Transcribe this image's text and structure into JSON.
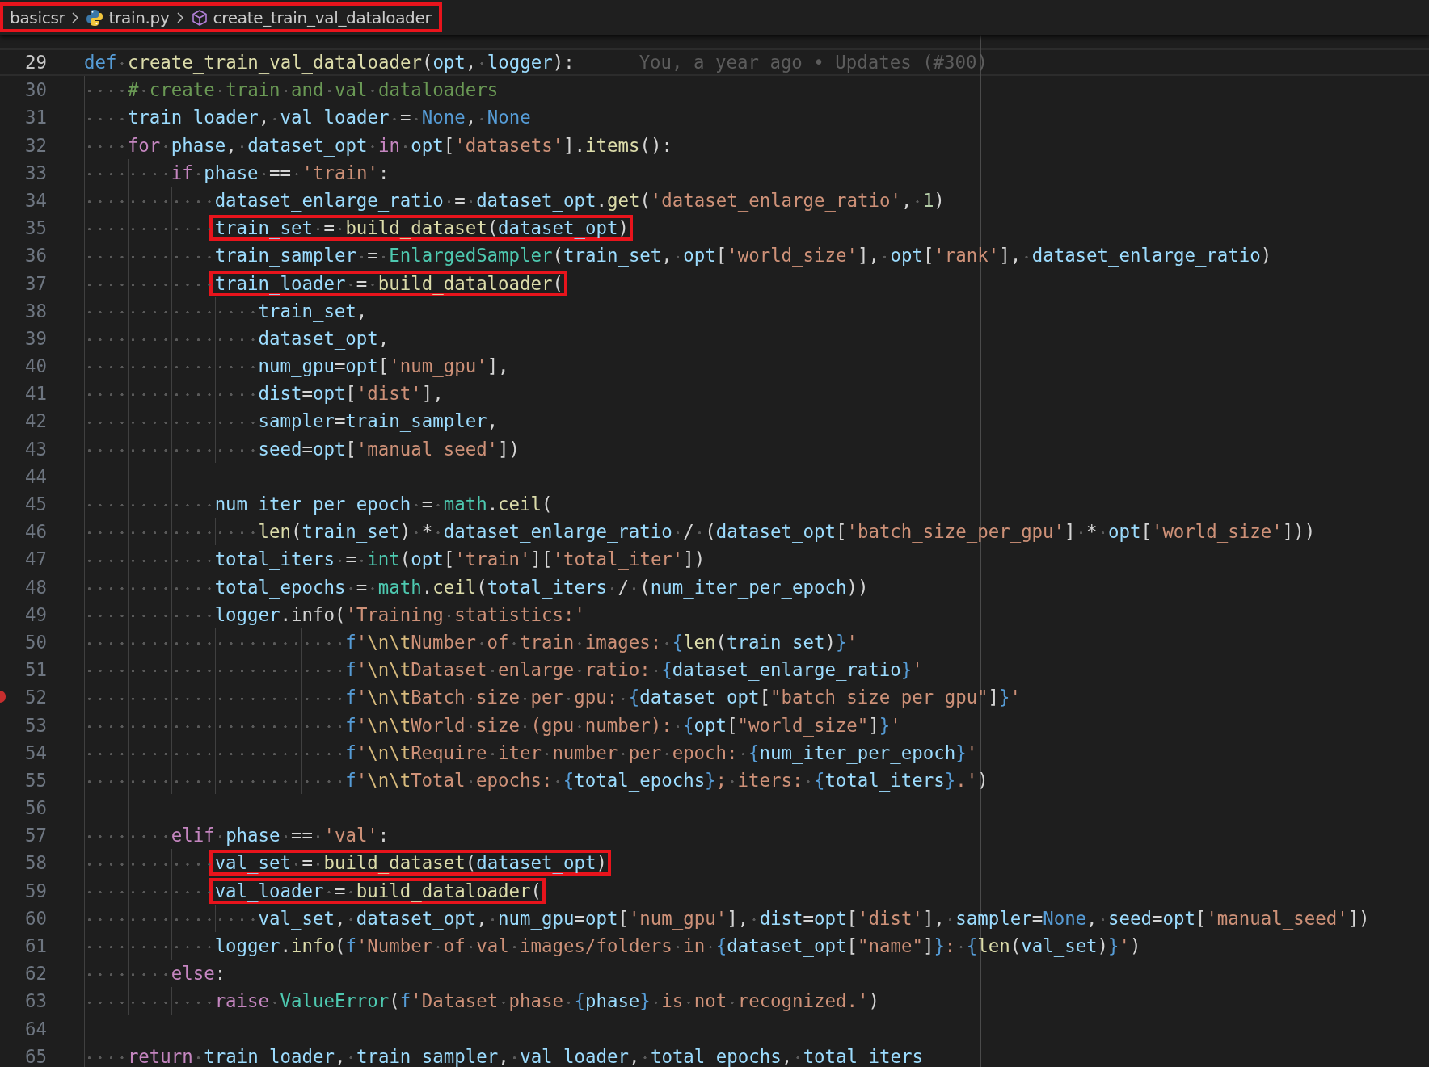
{
  "breadcrumb": {
    "boxed": true,
    "items": [
      {
        "label": "basicsr",
        "kind": "folder"
      },
      {
        "label": "train.py",
        "kind": "file"
      },
      {
        "label": "create_train_val_dataloader",
        "kind": "symbol"
      }
    ]
  },
  "lines": [
    {
      "number": "29",
      "current": true,
      "blame": "You, a year ago • Updates (#300)",
      "tokens": [
        {
          "kind": "keyword",
          "text": "def "
        },
        {
          "kind": "function",
          "text": "create_train_val_dataloader"
        },
        {
          "kind": "punct",
          "text": "("
        },
        {
          "kind": "variable",
          "text": "opt"
        },
        {
          "kind": "punct",
          "text": ", "
        },
        {
          "kind": "variable",
          "text": "logger"
        },
        {
          "kind": "punct",
          "text": "):"
        }
      ]
    },
    {
      "number": "30",
      "tokens": [
        {
          "kind": "comment",
          "text": "    # create train and val dataloaders"
        }
      ]
    },
    {
      "number": "31",
      "tokens": [
        {
          "kind": "variable",
          "text": "    train_loader"
        },
        {
          "kind": "punct",
          "text": ", "
        },
        {
          "kind": "variable",
          "text": "val_loader"
        },
        {
          "kind": "punct",
          "text": " = "
        },
        {
          "kind": "keyword",
          "text": "None"
        },
        {
          "kind": "punct",
          "text": ", "
        },
        {
          "kind": "keyword",
          "text": "None"
        }
      ]
    },
    {
      "number": "32",
      "tokens": [
        {
          "kind": "control",
          "text": "    for "
        },
        {
          "kind": "variable",
          "text": "phase"
        },
        {
          "kind": "punct",
          "text": ", "
        },
        {
          "kind": "variable",
          "text": "dataset_opt"
        },
        {
          "kind": "control",
          "text": " in "
        },
        {
          "kind": "variable",
          "text": "opt"
        },
        {
          "kind": "punct",
          "text": "["
        },
        {
          "kind": "string",
          "text": "'datasets'"
        },
        {
          "kind": "punct",
          "text": "]."
        },
        {
          "kind": "function",
          "text": "items"
        },
        {
          "kind": "punct",
          "text": "():"
        }
      ]
    },
    {
      "number": "33",
      "tokens": [
        {
          "kind": "control",
          "text": "        if "
        },
        {
          "kind": "variable",
          "text": "phase"
        },
        {
          "kind": "punct",
          "text": " == "
        },
        {
          "kind": "string",
          "text": "'train'"
        },
        {
          "kind": "punct",
          "text": ":"
        }
      ]
    },
    {
      "number": "34",
      "tokens": [
        {
          "kind": "variable",
          "text": "            dataset_enlarge_ratio"
        },
        {
          "kind": "punct",
          "text": " = "
        },
        {
          "kind": "variable",
          "text": "dataset_opt"
        },
        {
          "kind": "punct",
          "text": "."
        },
        {
          "kind": "function",
          "text": "get"
        },
        {
          "kind": "punct",
          "text": "("
        },
        {
          "kind": "string",
          "text": "'dataset_enlarge_ratio'"
        },
        {
          "kind": "punct",
          "text": ", "
        },
        {
          "kind": "number",
          "text": "1"
        },
        {
          "kind": "punct",
          "text": ")"
        }
      ]
    },
    {
      "number": "35",
      "boxed": true,
      "tokens": [
        {
          "kind": "variable",
          "text": "            train_set"
        },
        {
          "kind": "punct",
          "text": " = "
        },
        {
          "kind": "function",
          "text": "build_dataset"
        },
        {
          "kind": "punct",
          "text": "("
        },
        {
          "kind": "variable",
          "text": "dataset_opt"
        },
        {
          "kind": "punct",
          "text": ")"
        }
      ]
    },
    {
      "number": "36",
      "tokens": [
        {
          "kind": "variable",
          "text": "            train_sampler"
        },
        {
          "kind": "punct",
          "text": " = "
        },
        {
          "kind": "type",
          "text": "EnlargedSampler"
        },
        {
          "kind": "punct",
          "text": "("
        },
        {
          "kind": "variable",
          "text": "train_set"
        },
        {
          "kind": "punct",
          "text": ", "
        },
        {
          "kind": "variable",
          "text": "opt"
        },
        {
          "kind": "punct",
          "text": "["
        },
        {
          "kind": "string",
          "text": "'world_size'"
        },
        {
          "kind": "punct",
          "text": "], "
        },
        {
          "kind": "variable",
          "text": "opt"
        },
        {
          "kind": "punct",
          "text": "["
        },
        {
          "kind": "string",
          "text": "'rank'"
        },
        {
          "kind": "punct",
          "text": "], "
        },
        {
          "kind": "variable",
          "text": "dataset_enlarge_ratio"
        },
        {
          "kind": "punct",
          "text": ")"
        }
      ]
    },
    {
      "number": "37",
      "boxed": true,
      "tokens": [
        {
          "kind": "variable",
          "text": "            train_loader"
        },
        {
          "kind": "punct",
          "text": " = "
        },
        {
          "kind": "function",
          "text": "build_dataloader"
        },
        {
          "kind": "punct",
          "text": "("
        }
      ]
    },
    {
      "number": "38",
      "tokens": [
        {
          "kind": "variable",
          "text": "                train_set"
        },
        {
          "kind": "punct",
          "text": ","
        }
      ]
    },
    {
      "number": "39",
      "tokens": [
        {
          "kind": "variable",
          "text": "                dataset_opt"
        },
        {
          "kind": "punct",
          "text": ","
        }
      ]
    },
    {
      "number": "40",
      "tokens": [
        {
          "kind": "variable",
          "text": "                num_gpu"
        },
        {
          "kind": "punct",
          "text": "="
        },
        {
          "kind": "variable",
          "text": "opt"
        },
        {
          "kind": "punct",
          "text": "["
        },
        {
          "kind": "string",
          "text": "'num_gpu'"
        },
        {
          "kind": "punct",
          "text": "],"
        }
      ]
    },
    {
      "number": "41",
      "tokens": [
        {
          "kind": "variable",
          "text": "                dist"
        },
        {
          "kind": "punct",
          "text": "="
        },
        {
          "kind": "variable",
          "text": "opt"
        },
        {
          "kind": "punct",
          "text": "["
        },
        {
          "kind": "string",
          "text": "'dist'"
        },
        {
          "kind": "punct",
          "text": "],"
        }
      ]
    },
    {
      "number": "42",
      "tokens": [
        {
          "kind": "variable",
          "text": "                sampler"
        },
        {
          "kind": "punct",
          "text": "="
        },
        {
          "kind": "variable",
          "text": "train_sampler"
        },
        {
          "kind": "punct",
          "text": ","
        }
      ]
    },
    {
      "number": "43",
      "tokens": [
        {
          "kind": "variable",
          "text": "                seed"
        },
        {
          "kind": "punct",
          "text": "="
        },
        {
          "kind": "variable",
          "text": "opt"
        },
        {
          "kind": "punct",
          "text": "["
        },
        {
          "kind": "string",
          "text": "'manual_seed'"
        },
        {
          "kind": "punct",
          "text": "])"
        }
      ]
    },
    {
      "number": "44"
    },
    {
      "number": "45",
      "tokens": [
        {
          "kind": "variable",
          "text": "            num_iter_per_epoch"
        },
        {
          "kind": "punct",
          "text": " = "
        },
        {
          "kind": "type",
          "text": "math"
        },
        {
          "kind": "punct",
          "text": "."
        },
        {
          "kind": "function",
          "text": "ceil"
        },
        {
          "kind": "punct",
          "text": "("
        }
      ]
    },
    {
      "number": "46",
      "tokens": [
        {
          "kind": "function",
          "text": "                len"
        },
        {
          "kind": "punct",
          "text": "("
        },
        {
          "kind": "variable",
          "text": "train_set"
        },
        {
          "kind": "punct",
          "text": ") * "
        },
        {
          "kind": "variable",
          "text": "dataset_enlarge_ratio"
        },
        {
          "kind": "punct",
          "text": " / ("
        },
        {
          "kind": "variable",
          "text": "dataset_opt"
        },
        {
          "kind": "punct",
          "text": "["
        },
        {
          "kind": "string",
          "text": "'batch_size_per_gpu'"
        },
        {
          "kind": "punct",
          "text": "] * "
        },
        {
          "kind": "variable",
          "text": "opt"
        },
        {
          "kind": "punct",
          "text": "["
        },
        {
          "kind": "string",
          "text": "'world_size'"
        },
        {
          "kind": "punct",
          "text": "]))"
        }
      ]
    },
    {
      "number": "47",
      "tokens": [
        {
          "kind": "variable",
          "text": "            total_iters"
        },
        {
          "kind": "punct",
          "text": " = "
        },
        {
          "kind": "type",
          "text": "int"
        },
        {
          "kind": "punct",
          "text": "("
        },
        {
          "kind": "variable",
          "text": "opt"
        },
        {
          "kind": "punct",
          "text": "["
        },
        {
          "kind": "string",
          "text": "'train'"
        },
        {
          "kind": "punct",
          "text": "]["
        },
        {
          "kind": "string",
          "text": "'total_iter'"
        },
        {
          "kind": "punct",
          "text": "])"
        }
      ]
    },
    {
      "number": "48",
      "tokens": [
        {
          "kind": "variable",
          "text": "            total_epochs"
        },
        {
          "kind": "punct",
          "text": " = "
        },
        {
          "kind": "type",
          "text": "math"
        },
        {
          "kind": "punct",
          "text": "."
        },
        {
          "kind": "function",
          "text": "ceil"
        },
        {
          "kind": "punct",
          "text": "("
        },
        {
          "kind": "variable",
          "text": "total_iters"
        },
        {
          "kind": "punct",
          "text": " / ("
        },
        {
          "kind": "variable",
          "text": "num_iter_per_epoch"
        },
        {
          "kind": "punct",
          "text": "))"
        }
      ]
    },
    {
      "number": "49",
      "tokens": [
        {
          "kind": "variable",
          "text": "            logger"
        },
        {
          "kind": "punct",
          "text": ".info"
        },
        {
          "kind": "punct",
          "text": "("
        },
        {
          "kind": "string",
          "text": "'Training statistics:'"
        }
      ]
    },
    {
      "number": "50",
      "tokens": [
        {
          "kind": "keyword",
          "text": "                        f"
        },
        {
          "kind": "string",
          "text": "'"
        },
        {
          "kind": "escape",
          "text": "\\n\\t"
        },
        {
          "kind": "string",
          "text": "Number of train images: "
        },
        {
          "kind": "keyword",
          "text": "{"
        },
        {
          "kind": "function",
          "text": "len"
        },
        {
          "kind": "punct",
          "text": "("
        },
        {
          "kind": "variable",
          "text": "train_set"
        },
        {
          "kind": "punct",
          "text": ")"
        },
        {
          "kind": "keyword",
          "text": "}"
        },
        {
          "kind": "string",
          "text": "'"
        }
      ]
    },
    {
      "number": "51",
      "tokens": [
        {
          "kind": "keyword",
          "text": "                        f"
        },
        {
          "kind": "string",
          "text": "'"
        },
        {
          "kind": "escape",
          "text": "\\n\\t"
        },
        {
          "kind": "string",
          "text": "Dataset enlarge ratio: "
        },
        {
          "kind": "keyword",
          "text": "{"
        },
        {
          "kind": "variable",
          "text": "dataset_enlarge_ratio"
        },
        {
          "kind": "keyword",
          "text": "}"
        },
        {
          "kind": "string",
          "text": "'"
        }
      ]
    },
    {
      "number": "52",
      "breakpoint": true,
      "tokens": [
        {
          "kind": "keyword",
          "text": "                        f"
        },
        {
          "kind": "string",
          "text": "'"
        },
        {
          "kind": "escape",
          "text": "\\n\\t"
        },
        {
          "kind": "string",
          "text": "Batch size per gpu: "
        },
        {
          "kind": "keyword",
          "text": "{"
        },
        {
          "kind": "variable",
          "text": "dataset_opt"
        },
        {
          "kind": "punct",
          "text": "["
        },
        {
          "kind": "string",
          "text": "\"batch_size_per_gpu\""
        },
        {
          "kind": "punct",
          "text": "]"
        },
        {
          "kind": "keyword",
          "text": "}"
        },
        {
          "kind": "string",
          "text": "'"
        }
      ]
    },
    {
      "number": "53",
      "tokens": [
        {
          "kind": "keyword",
          "text": "                        f"
        },
        {
          "kind": "string",
          "text": "'"
        },
        {
          "kind": "escape",
          "text": "\\n\\t"
        },
        {
          "kind": "string",
          "text": "World size (gpu number): "
        },
        {
          "kind": "keyword",
          "text": "{"
        },
        {
          "kind": "variable",
          "text": "opt"
        },
        {
          "kind": "punct",
          "text": "["
        },
        {
          "kind": "string",
          "text": "\"world_size\""
        },
        {
          "kind": "punct",
          "text": "]"
        },
        {
          "kind": "keyword",
          "text": "}"
        },
        {
          "kind": "string",
          "text": "'"
        }
      ]
    },
    {
      "number": "54",
      "tokens": [
        {
          "kind": "keyword",
          "text": "                        f"
        },
        {
          "kind": "string",
          "text": "'"
        },
        {
          "kind": "escape",
          "text": "\\n\\t"
        },
        {
          "kind": "string",
          "text": "Require iter number per epoch: "
        },
        {
          "kind": "keyword",
          "text": "{"
        },
        {
          "kind": "variable",
          "text": "num_iter_per_epoch"
        },
        {
          "kind": "keyword",
          "text": "}"
        },
        {
          "kind": "string",
          "text": "'"
        }
      ]
    },
    {
      "number": "55",
      "tokens": [
        {
          "kind": "keyword",
          "text": "                        f"
        },
        {
          "kind": "string",
          "text": "'"
        },
        {
          "kind": "escape",
          "text": "\\n\\t"
        },
        {
          "kind": "string",
          "text": "Total epochs: "
        },
        {
          "kind": "keyword",
          "text": "{"
        },
        {
          "kind": "variable",
          "text": "total_epochs"
        },
        {
          "kind": "keyword",
          "text": "}"
        },
        {
          "kind": "string",
          "text": "; iters: "
        },
        {
          "kind": "keyword",
          "text": "{"
        },
        {
          "kind": "variable",
          "text": "total_iters"
        },
        {
          "kind": "keyword",
          "text": "}"
        },
        {
          "kind": "string",
          "text": ".'"
        },
        {
          "kind": "punct",
          "text": ")"
        }
      ]
    },
    {
      "number": "56"
    },
    {
      "number": "57",
      "tokens": [
        {
          "kind": "control",
          "text": "        elif "
        },
        {
          "kind": "variable",
          "text": "phase"
        },
        {
          "kind": "punct",
          "text": " == "
        },
        {
          "kind": "string",
          "text": "'val'"
        },
        {
          "kind": "punct",
          "text": ":"
        }
      ]
    },
    {
      "number": "58",
      "boxed": true,
      "tokens": [
        {
          "kind": "variable",
          "text": "            val_set"
        },
        {
          "kind": "punct",
          "text": " = "
        },
        {
          "kind": "function",
          "text": "build_dataset"
        },
        {
          "kind": "punct",
          "text": "("
        },
        {
          "kind": "variable",
          "text": "dataset_opt"
        },
        {
          "kind": "punct",
          "text": ")"
        }
      ]
    },
    {
      "number": "59",
      "boxed": true,
      "tokens": [
        {
          "kind": "variable",
          "text": "            val_loader"
        },
        {
          "kind": "punct",
          "text": " = "
        },
        {
          "kind": "function",
          "text": "build_dataloader"
        },
        {
          "kind": "punct",
          "text": "("
        }
      ]
    },
    {
      "number": "60",
      "tokens": [
        {
          "kind": "variable",
          "text": "                val_set"
        },
        {
          "kind": "punct",
          "text": ", "
        },
        {
          "kind": "variable",
          "text": "dataset_opt"
        },
        {
          "kind": "punct",
          "text": ", "
        },
        {
          "kind": "variable",
          "text": "num_gpu"
        },
        {
          "kind": "punct",
          "text": "="
        },
        {
          "kind": "variable",
          "text": "opt"
        },
        {
          "kind": "punct",
          "text": "["
        },
        {
          "kind": "string",
          "text": "'num_gpu'"
        },
        {
          "kind": "punct",
          "text": "], "
        },
        {
          "kind": "variable",
          "text": "dist"
        },
        {
          "kind": "punct",
          "text": "="
        },
        {
          "kind": "variable",
          "text": "opt"
        },
        {
          "kind": "punct",
          "text": "["
        },
        {
          "kind": "string",
          "text": "'dist'"
        },
        {
          "kind": "punct",
          "text": "], "
        },
        {
          "kind": "variable",
          "text": "sampler"
        },
        {
          "kind": "punct",
          "text": "="
        },
        {
          "kind": "keyword",
          "text": "None"
        },
        {
          "kind": "punct",
          "text": ", "
        },
        {
          "kind": "variable",
          "text": "seed"
        },
        {
          "kind": "punct",
          "text": "="
        },
        {
          "kind": "variable",
          "text": "opt"
        },
        {
          "kind": "punct",
          "text": "["
        },
        {
          "kind": "string",
          "text": "'manual_seed'"
        },
        {
          "kind": "punct",
          "text": "])"
        }
      ]
    },
    {
      "number": "61",
      "tokens": [
        {
          "kind": "variable",
          "text": "            logger"
        },
        {
          "kind": "punct",
          "text": "."
        },
        {
          "kind": "function",
          "text": "info"
        },
        {
          "kind": "punct",
          "text": "("
        },
        {
          "kind": "keyword",
          "text": "f"
        },
        {
          "kind": "string",
          "text": "'Number of val images/folders in "
        },
        {
          "kind": "keyword",
          "text": "{"
        },
        {
          "kind": "variable",
          "text": "dataset_opt"
        },
        {
          "kind": "punct",
          "text": "["
        },
        {
          "kind": "string",
          "text": "\"name\""
        },
        {
          "kind": "punct",
          "text": "]"
        },
        {
          "kind": "keyword",
          "text": "}"
        },
        {
          "kind": "string",
          "text": ": "
        },
        {
          "kind": "keyword",
          "text": "{"
        },
        {
          "kind": "function",
          "text": "len"
        },
        {
          "kind": "punct",
          "text": "("
        },
        {
          "kind": "variable",
          "text": "val_set"
        },
        {
          "kind": "punct",
          "text": ")"
        },
        {
          "kind": "keyword",
          "text": "}"
        },
        {
          "kind": "string",
          "text": "'"
        },
        {
          "kind": "punct",
          "text": ")"
        }
      ]
    },
    {
      "number": "62",
      "tokens": [
        {
          "kind": "control",
          "text": "        else"
        },
        {
          "kind": "punct",
          "text": ":"
        }
      ]
    },
    {
      "number": "63",
      "tokens": [
        {
          "kind": "control",
          "text": "            raise "
        },
        {
          "kind": "type",
          "text": "ValueError"
        },
        {
          "kind": "punct",
          "text": "("
        },
        {
          "kind": "keyword",
          "text": "f"
        },
        {
          "kind": "string",
          "text": "'Dataset phase "
        },
        {
          "kind": "keyword",
          "text": "{"
        },
        {
          "kind": "variable",
          "text": "phase"
        },
        {
          "kind": "keyword",
          "text": "}"
        },
        {
          "kind": "string",
          "text": " is not recognized.'"
        },
        {
          "kind": "punct",
          "text": ")"
        }
      ]
    },
    {
      "number": "64"
    },
    {
      "number": "65",
      "tokens": [
        {
          "kind": "control",
          "text": "    return "
        },
        {
          "kind": "variable",
          "text": "train_loader"
        },
        {
          "kind": "punct",
          "text": ", "
        },
        {
          "kind": "variable",
          "text": "train_sampler"
        },
        {
          "kind": "punct",
          "text": ", "
        },
        {
          "kind": "variable",
          "text": "val_loader"
        },
        {
          "kind": "punct",
          "text": ", "
        },
        {
          "kind": "variable",
          "text": "total_epochs"
        },
        {
          "kind": "punct",
          "text": ", "
        },
        {
          "kind": "variable",
          "text": "total_iters"
        }
      ]
    }
  ]
}
